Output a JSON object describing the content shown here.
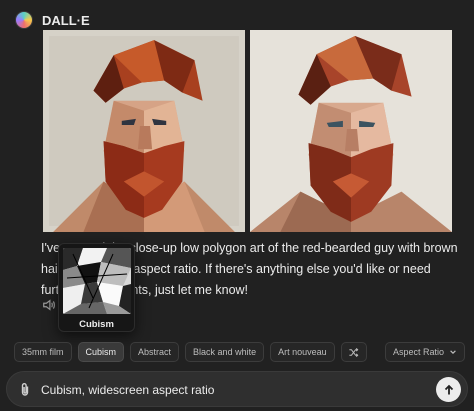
{
  "header": {
    "bot_name": "DALL·E"
  },
  "images": [
    {
      "icon": "generated-portrait-1"
    },
    {
      "icon": "generated-portrait-2"
    }
  ],
  "message": {
    "text": "I've created the close-up low polygon art of the red-bearded guy with brown hair, in a square aspect ratio. If there's anything else you'd like or need further adjustments, just let me know!"
  },
  "tooltip": {
    "label": "Cubism"
  },
  "style_chips": [
    {
      "label": "35mm film",
      "active": false
    },
    {
      "label": "Cubism",
      "active": true
    },
    {
      "label": "Abstract",
      "active": false
    },
    {
      "label": "Black and white",
      "active": false
    },
    {
      "label": "Art nouveau",
      "active": false
    }
  ],
  "aspect_button": {
    "label": "Aspect Ratio"
  },
  "composer": {
    "value": "Cubism, widescreen aspect ratio"
  },
  "colors": {
    "background": "#212121",
    "composer": "#2f2f2f",
    "text": "#ececec"
  }
}
